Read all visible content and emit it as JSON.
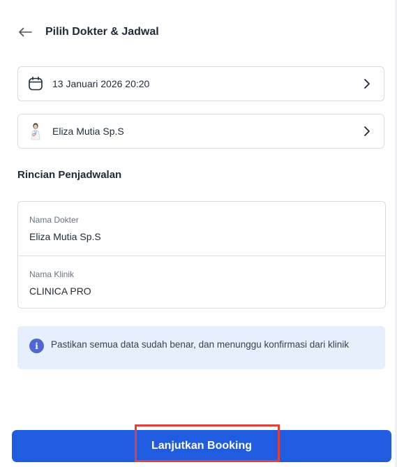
{
  "header": {
    "title": "Pilih Dokter & Jadwal",
    "back_icon": "arrow-left-icon"
  },
  "schedule": {
    "datetime": "13 Januari 2026 20:20",
    "icon": "calendar-icon"
  },
  "doctor": {
    "name": "Eliza Mutia Sp.S",
    "icon": "doctor-avatar"
  },
  "details": {
    "section_title": "Rincian Penjadwalan",
    "doctor_label": "Nama Dokter",
    "doctor_value": "Eliza Mutia Sp.S",
    "clinic_label": "Nama Klinik",
    "clinic_value": "CLINICA PRO"
  },
  "notice": {
    "icon": "info-icon",
    "text": "Pastikan semua data sudah benar, dan menunggu konfirmasi dari klinik"
  },
  "cta": {
    "label": "Lanjutkan Booking"
  },
  "colors": {
    "primary": "#1f5ce0",
    "info_bg": "#e6f0fd",
    "info_icon": "#4f66d6",
    "highlight": "#e0413a"
  }
}
